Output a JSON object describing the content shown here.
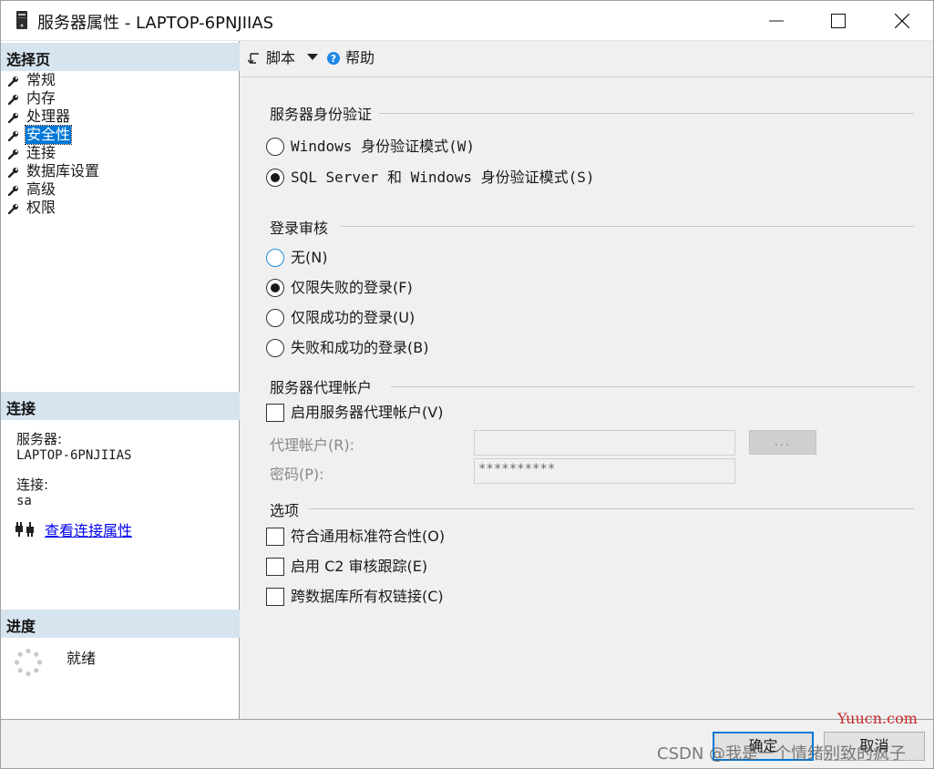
{
  "window": {
    "title": "服务器属性 - LAPTOP-6PNJIIAS"
  },
  "left": {
    "select_page_header": "选择页",
    "nav_items": [
      {
        "label": "常规"
      },
      {
        "label": "内存"
      },
      {
        "label": "处理器"
      },
      {
        "label": "安全性",
        "selected": true
      },
      {
        "label": "连接"
      },
      {
        "label": "数据库设置"
      },
      {
        "label": "高级"
      },
      {
        "label": "权限"
      }
    ],
    "connection_header": "连接",
    "server_label": "服务器:",
    "server_value": "LAPTOP-6PNJIIAS",
    "connection_label": "连接:",
    "connection_value": "sa",
    "view_conn_props": "查看连接属性",
    "progress_header": "进度",
    "progress_status": "就绪"
  },
  "toolbar": {
    "script_label": "脚本",
    "help_label": "帮助"
  },
  "auth": {
    "title": "服务器身份验证",
    "windows_mode": "Windows 身份验证模式(W)",
    "mixed_mode": "SQL Server 和 Windows 身份验证模式(S)",
    "selected": "mixed"
  },
  "audit": {
    "title": "登录审核",
    "none": "无(N)",
    "failed_only": "仅限失败的登录(F)",
    "success_only": "仅限成功的登录(U)",
    "both": "失败和成功的登录(B)",
    "selected": "failed_only"
  },
  "proxy": {
    "title": "服务器代理帐户",
    "enable_label": "启用服务器代理帐户(V)",
    "enabled": false,
    "account_label": "代理帐户(R):",
    "account_value": "",
    "password_label": "密码(P):",
    "password_value": "**********",
    "browse_label": "..."
  },
  "options": {
    "title": "选项",
    "common_criteria": "符合通用标准符合性(O)",
    "c2_audit": "启用 C2 审核跟踪(E)",
    "cross_db": "跨数据库所有权链接(C)"
  },
  "buttons": {
    "ok": "确定",
    "cancel": "取消"
  },
  "watermark": {
    "site": "Yuucn.com",
    "author": "CSDN @我是一个情绪别致的疯子"
  },
  "colors": {
    "accent": "#0078d7",
    "section_header_bg": "#d6e4f0",
    "link": "#0000ee"
  }
}
